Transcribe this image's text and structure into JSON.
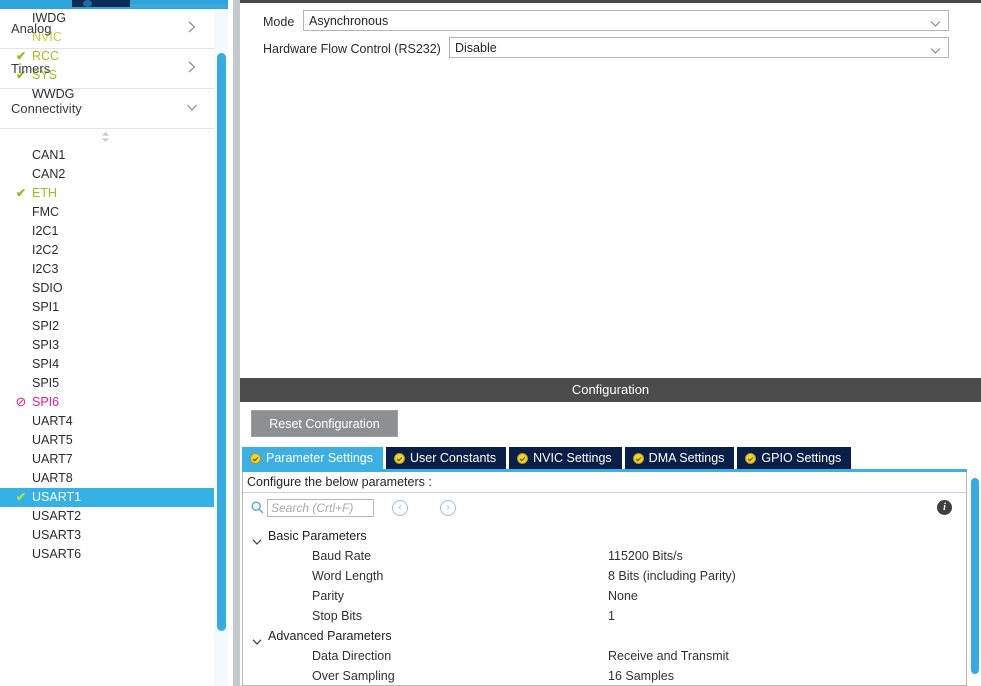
{
  "left_panel": {
    "peripherals_top": [
      {
        "label": "IWDG",
        "state": "none"
      },
      {
        "label": "NVIC",
        "state": "warn"
      },
      {
        "label": "RCC",
        "state": "on"
      },
      {
        "label": "SYS",
        "state": "on"
      },
      {
        "label": "WWDG",
        "state": "none"
      }
    ],
    "groups": [
      {
        "label": "Analog",
        "expanded": false,
        "arrow": "chevron-right-icon"
      },
      {
        "label": "Timers",
        "expanded": false,
        "arrow": "chevron-right-icon"
      },
      {
        "label": "Connectivity",
        "expanded": true,
        "arrow": "chevron-down-icon"
      }
    ],
    "connectivity_items": [
      {
        "label": "CAN1",
        "state": "none"
      },
      {
        "label": "CAN2",
        "state": "none"
      },
      {
        "label": "ETH",
        "state": "on"
      },
      {
        "label": "FMC",
        "state": "none"
      },
      {
        "label": "I2C1",
        "state": "none"
      },
      {
        "label": "I2C2",
        "state": "none"
      },
      {
        "label": "I2C3",
        "state": "none"
      },
      {
        "label": "SDIO",
        "state": "none"
      },
      {
        "label": "SPI1",
        "state": "none"
      },
      {
        "label": "SPI2",
        "state": "none"
      },
      {
        "label": "SPI3",
        "state": "none"
      },
      {
        "label": "SPI4",
        "state": "none"
      },
      {
        "label": "SPI5",
        "state": "none"
      },
      {
        "label": "SPI6",
        "state": "err"
      },
      {
        "label": "UART4",
        "state": "none"
      },
      {
        "label": "UART5",
        "state": "none"
      },
      {
        "label": "UART7",
        "state": "none"
      },
      {
        "label": "UART8",
        "state": "none"
      },
      {
        "label": "USART1",
        "state": "on",
        "selected": true
      },
      {
        "label": "USART2",
        "state": "none"
      },
      {
        "label": "USART3",
        "state": "none"
      },
      {
        "label": "USART6",
        "state": "none"
      }
    ]
  },
  "mode_panel": {
    "rows": [
      {
        "label": "Mode",
        "value": "Asynchronous"
      },
      {
        "label": "Hardware Flow Control (RS232)",
        "value": "Disable"
      }
    ]
  },
  "configuration": {
    "title": "Configuration",
    "reset_button": "Reset Configuration",
    "tabs": [
      {
        "label": "Parameter Settings",
        "active": true
      },
      {
        "label": "User Constants",
        "active": false
      },
      {
        "label": "NVIC Settings",
        "active": false
      },
      {
        "label": "DMA Settings",
        "active": false
      },
      {
        "label": "GPIO Settings",
        "active": false
      }
    ],
    "prompt": "Configure the below parameters :",
    "search_placeholder": "Search (Crtl+F)",
    "search_value": "",
    "nav_prev": "‹",
    "nav_next": "›",
    "info_glyph": "i",
    "tree": [
      {
        "type": "group",
        "label": "Basic Parameters"
      },
      {
        "type": "row",
        "name": "Baud Rate",
        "value": "115200 Bits/s"
      },
      {
        "type": "row",
        "name": "Word Length",
        "value": "8 Bits (including Parity)"
      },
      {
        "type": "row",
        "name": "Parity",
        "value": "None"
      },
      {
        "type": "row",
        "name": "Stop Bits",
        "value": "1"
      },
      {
        "type": "group",
        "label": "Advanced Parameters"
      },
      {
        "type": "row",
        "name": "Data Direction",
        "value": "Receive and Transmit"
      },
      {
        "type": "row",
        "name": "Over Sampling",
        "value": "16 Samples"
      }
    ]
  },
  "colors": {
    "accent_blue": "#35b2e3",
    "tab_inactive": "#0a1f47",
    "state_on": "#a4bd1e",
    "state_warn": "#cfcf3d",
    "state_err": "#e0218a",
    "header_gray": "#4c4c4c"
  }
}
